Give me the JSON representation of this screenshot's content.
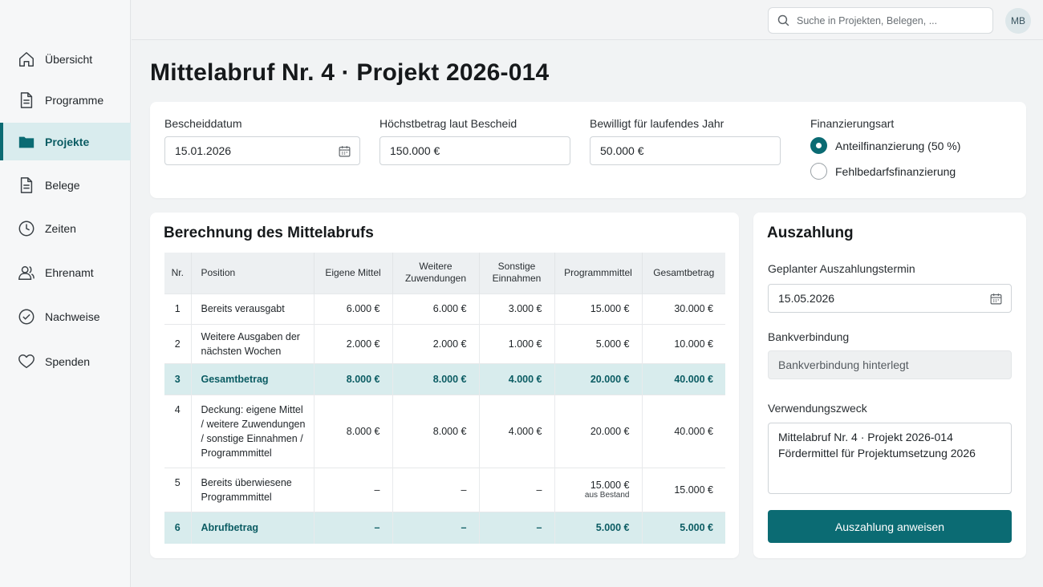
{
  "sidebar": {
    "items": [
      {
        "label": "Übersicht",
        "icon": "home-icon",
        "active": false
      },
      {
        "label": "Programme",
        "icon": "document-icon",
        "active": false
      },
      {
        "label": "Projekte",
        "icon": "folder-icon",
        "active": true
      },
      {
        "label": "Belege",
        "icon": "document-icon",
        "active": false
      },
      {
        "label": "Zeiten",
        "icon": "clock-icon",
        "active": false
      },
      {
        "label": "Ehrenamt",
        "icon": "users-icon",
        "active": false
      },
      {
        "label": "Nachweise",
        "icon": "check-circle-icon",
        "active": false
      },
      {
        "label": "Spenden",
        "icon": "heart-icon",
        "active": false
      }
    ]
  },
  "header": {
    "search_placeholder": "Suche in Projekten, Belegen, ...",
    "avatar_initials": "MB"
  },
  "page": {
    "title": "Mittelabruf Nr. 4 · Projekt 2026-014"
  },
  "bescheid": {
    "date_label": "Bescheiddatum",
    "date_value": "15.01.2026",
    "max_label": "Höchstbetrag laut Bescheid",
    "max_value": "150.000 €",
    "year_label": "Bewilligt für laufendes Jahr",
    "year_value": "50.000 €",
    "financing_label": "Finanzierungsart",
    "financing_options": [
      {
        "label": "Anteilfinanzierung (50 %)",
        "checked": true
      },
      {
        "label": "Fehlbedarfsfinanzierung",
        "checked": false
      }
    ]
  },
  "calculation": {
    "title": "Berechnung des Mittelabrufs",
    "headers": [
      "Nr.",
      "Position",
      "Eigene Mittel",
      "Weitere Zuwendungen",
      "Sonstige Einnahmen",
      "Programmmittel",
      "Gesamtbetrag"
    ],
    "rows": [
      {
        "nr": "1",
        "position": "Bereits verausgabt",
        "eigene": "6.000 €",
        "weitere": "6.000 €",
        "sonstige": "3.000 €",
        "programm": "15.000 €",
        "programm_note": "",
        "gesamt": "30.000 €",
        "highlight": false
      },
      {
        "nr": "2",
        "position": "Weitere Ausgaben der nächsten Wochen",
        "eigene": "2.000 €",
        "weitere": "2.000 €",
        "sonstige": "1.000 €",
        "programm": "5.000 €",
        "programm_note": "",
        "gesamt": "10.000 €",
        "highlight": false
      },
      {
        "nr": "3",
        "position": "Gesamtbetrag",
        "eigene": "8.000 €",
        "weitere": "8.000 €",
        "sonstige": "4.000 €",
        "programm": "20.000 €",
        "programm_note": "",
        "gesamt": "40.000 €",
        "highlight": true
      },
      {
        "nr": "4",
        "position": "Deckung: eigene Mittel / weitere Zuwendungen / sonstige Einnahmen / Programmmittel",
        "eigene": "8.000 €",
        "weitere": "8.000 €",
        "sonstige": "4.000 €",
        "programm": "20.000 €",
        "programm_note": "",
        "gesamt": "40.000 €",
        "highlight": false
      },
      {
        "nr": "5",
        "position": "Bereits überwiesene Programmmittel",
        "eigene": "–",
        "weitere": "–",
        "sonstige": "–",
        "programm": "15.000 €",
        "programm_note": "aus Bestand",
        "gesamt": "15.000 €",
        "highlight": false
      },
      {
        "nr": "6",
        "position": "Abrufbetrag",
        "eigene": "–",
        "weitere": "–",
        "sonstige": "–",
        "programm": "5.000 €",
        "programm_note": "",
        "gesamt": "5.000 €",
        "highlight": true
      }
    ]
  },
  "payout": {
    "title": "Auszahlung",
    "date_label": "Geplanter Auszahlungstermin",
    "date_value": "15.05.2026",
    "bank_label": "Bankverbindung",
    "bank_value": "Bankverbindung hinterlegt",
    "purpose_label": "Verwendungszweck",
    "purpose_line1": "Mittelabruf Nr. 4 · Projekt 2026-014",
    "purpose_line2": "Fördermittel für Projektumsetzung 2026",
    "button_label": "Auszahlung anweisen"
  },
  "colors": {
    "accent": "#0b6b73",
    "highlight_row": "#d8eced",
    "active_nav": "#d9ecee"
  }
}
